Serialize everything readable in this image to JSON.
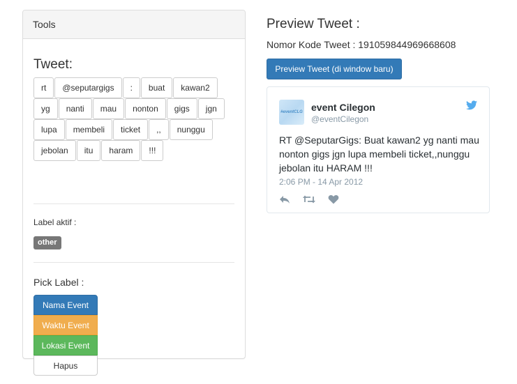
{
  "tools_panel": {
    "heading": "Tools",
    "tweet_heading": "Tweet:",
    "token_rows": [
      [
        "rt",
        "@seputargigs",
        ":",
        "buat",
        "kawan2"
      ],
      [
        "yg",
        "nanti",
        "mau",
        "nonton",
        "gigs",
        "jgn"
      ],
      [
        "lupa",
        "membeli",
        "ticket",
        ",,",
        "nunggu"
      ],
      [
        "jebolan",
        "itu",
        "haram",
        "!!!"
      ]
    ],
    "label_aktif": "Label aktif :",
    "active_badge": "other",
    "pick_label": "Pick Label :",
    "pick_buttons": [
      "Nama Event",
      "Waktu Event",
      "Lokasi Event",
      "Hapus"
    ]
  },
  "preview": {
    "title": "Preview Tweet :",
    "nomor_kode": "Nomor Kode Tweet : 191059844969668608",
    "button_label": "Preview Tweet (di window baru)",
    "tweet": {
      "avatar_text": "#eventCLG",
      "name": "event Cilegon",
      "handle": "@eventCilegon",
      "text": "RT @SeputarGigs: Buat kawan2 yg nanti mau nonton gigs jgn lupa membeli ticket,,nunggu jebolan itu HARAM !!!",
      "time": "2:06 PM - 14 Apr 2012"
    }
  },
  "colors": {
    "primary": "#337ab7",
    "warning": "#f0ad4e",
    "success": "#5cb85c",
    "badge": "#777777",
    "twitter_blue": "#55acee"
  },
  "icons": {
    "twitter": "twitter-bird-icon",
    "reply": "reply-icon",
    "retweet": "retweet-icon",
    "like": "heart-icon"
  }
}
